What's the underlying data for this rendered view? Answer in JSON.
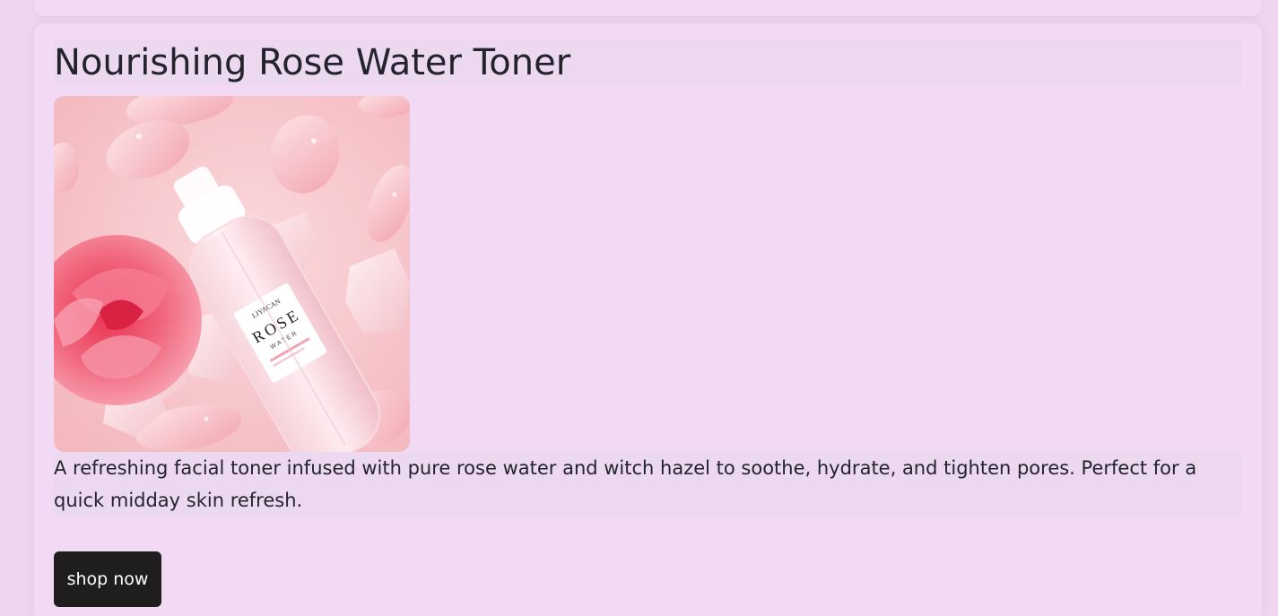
{
  "product": {
    "title": "Nourishing Rose Water Toner",
    "image_label": "rose-water-toner-product-photo",
    "bottle_brand": "LIYACAN",
    "bottle_name_line1": "ROSE",
    "bottle_name_line2": "WATER",
    "description": "A refreshing facial toner infused with pure rose water and witch hazel to soothe, hydrate, and tighten pores. Perfect for a quick midday skin refresh.",
    "cta_label": "shop now"
  },
  "colors": {
    "page_background": "#efd6f0",
    "card_background": "#f3daf4",
    "text_highlight": "#ecd9f0",
    "button_background": "#1f1d1e",
    "button_text": "#ffffff",
    "text": "#23232d"
  }
}
